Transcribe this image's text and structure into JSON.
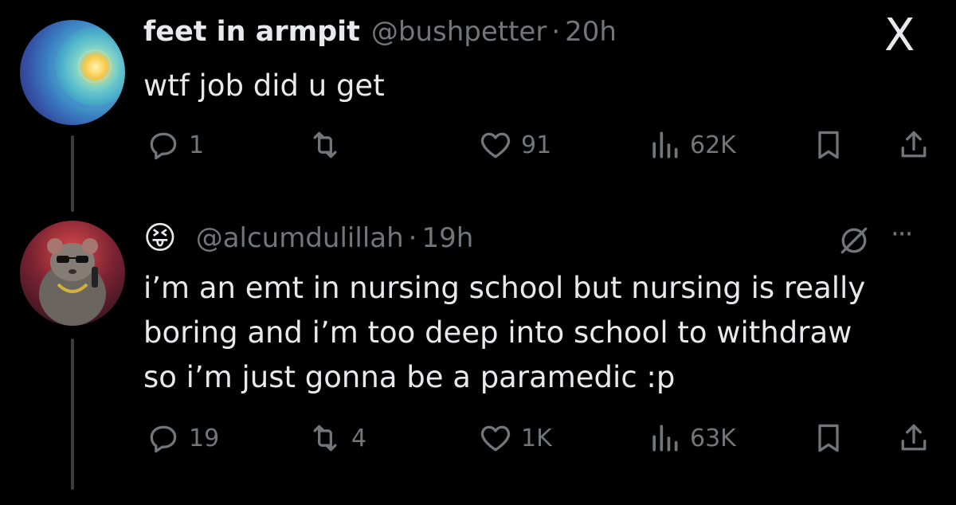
{
  "tweet1": {
    "display_name": "feet in armpit",
    "handle": "@bushpetter",
    "separator": "·",
    "time": "20h",
    "text": "wtf job did u get",
    "actions": {
      "replies": "1",
      "reposts": "",
      "likes": "91",
      "views": "62K"
    }
  },
  "tweet2": {
    "display_emoji": "😝",
    "handle": "@alcumdulillah",
    "separator": "·",
    "time": "19h",
    "text_lines": [
      "i’m an emt in nursing school but nursing is really",
      "boring and i’m too deep into school to withdraw",
      "so i’m just gonna be a paramedic :p"
    ],
    "actions": {
      "replies": "19",
      "reposts": "4",
      "likes": "1K",
      "views": "63K"
    }
  },
  "icons": {
    "close": "X",
    "more": "···"
  }
}
